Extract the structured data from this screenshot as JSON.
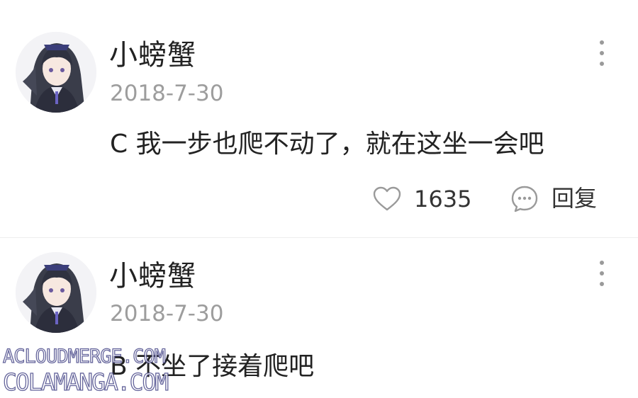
{
  "comments": [
    {
      "username": "小螃蟹",
      "date": "2018-7-30",
      "content": "C 我一步也爬不动了，就在这坐一会吧",
      "likes": "1635",
      "reply_label": "回复",
      "like_icon": "heart-outline-icon",
      "reply_icon": "chat-bubble-icon",
      "more_icon": "more-vertical-icon"
    },
    {
      "username": "小螃蟹",
      "date": "2018-7-30",
      "content": "B 不坐了接着爬吧",
      "more_icon": "more-vertical-icon"
    }
  ],
  "watermark": {
    "line1": "ACLOUDMERGE.COM",
    "line2": "COLAMANGA.COM"
  },
  "colors": {
    "text": "#222222",
    "muted": "#9d9d9d",
    "icon": "#9a9a9a",
    "divider": "#eeeeee",
    "watermark_outline": "#4a4a8a"
  }
}
